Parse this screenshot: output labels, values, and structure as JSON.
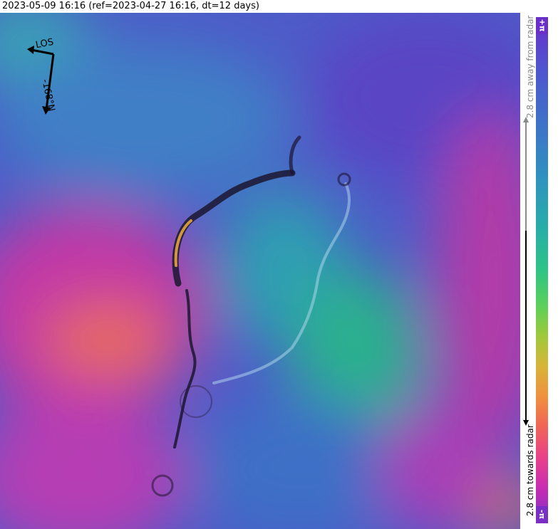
{
  "header": {
    "title": "2023-05-09 16:16 (ref=2023-04-27 16:16, dt=12 days)"
  },
  "compass": {
    "los_label": "LOS",
    "heading_label": "-168°N",
    "arrow_icon": "los-arrow-icon"
  },
  "colorbar": {
    "top_label": "+π",
    "bottom_label": "-π",
    "away_label": "2.8 cm away from radar",
    "towards_label": "2.8 cm towards radar",
    "colors": [
      "#6b2fc9",
      "#3c74c8",
      "#27aea8",
      "#5bd05a",
      "#d8b43a",
      "#f0903f",
      "#e8428a",
      "#7a2ec6"
    ]
  }
}
